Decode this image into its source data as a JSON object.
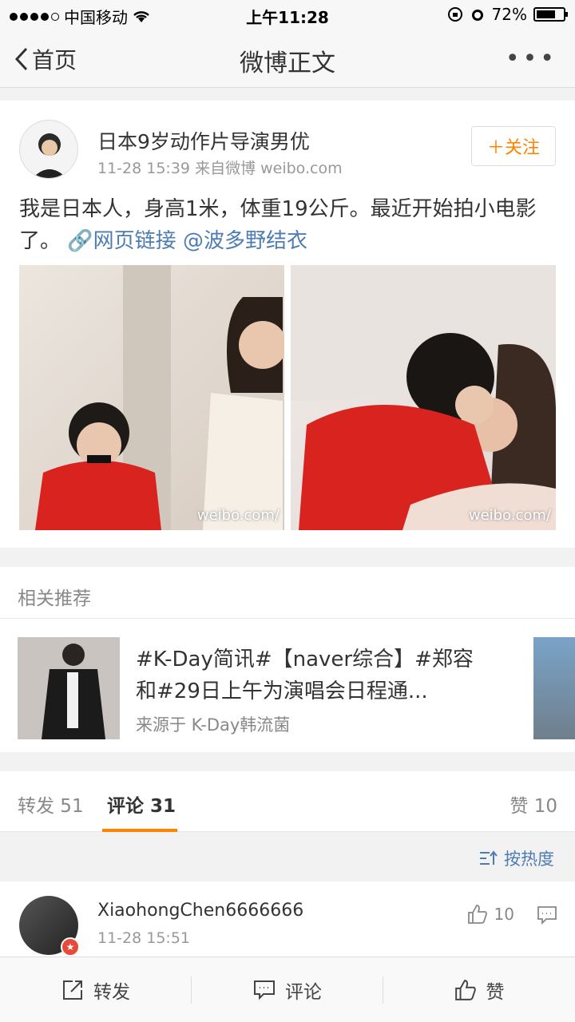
{
  "status_bar": {
    "carrier": "中国移动",
    "time": "上午11:28",
    "battery": "72%",
    "battery_level": 0.72
  },
  "nav": {
    "back_label": "首页",
    "title": "微博正文",
    "more": "•••"
  },
  "post": {
    "username": "日本9岁动作片导演男优",
    "time": "11-28 15:39",
    "source": "来自微博 weibo.com",
    "follow_label": "关注",
    "text_main": "我是日本人，身高1米，体重19公斤。最近开始拍小电影了。",
    "link_label": "网页链接",
    "mention": "@波多野结衣",
    "watermark_1": "weibo.com/",
    "watermark_2": "weibo.com/"
  },
  "related": {
    "header": "相关推荐",
    "item_title": "#K-Day简讯#【naver综合】#郑容和#29日上午为演唱会日程通...",
    "item_source": "来源于 K-Day韩流菌"
  },
  "tabs": {
    "repost": "转发 51",
    "comment": "评论 31",
    "like": "赞 10"
  },
  "sort": {
    "label": "按热度"
  },
  "comment": {
    "username": "XiaohongChen6666666",
    "time": "11-28 15:51",
    "likes": "10"
  },
  "toolbar": {
    "repost": "转发",
    "comment": "评论",
    "like": "赞"
  }
}
